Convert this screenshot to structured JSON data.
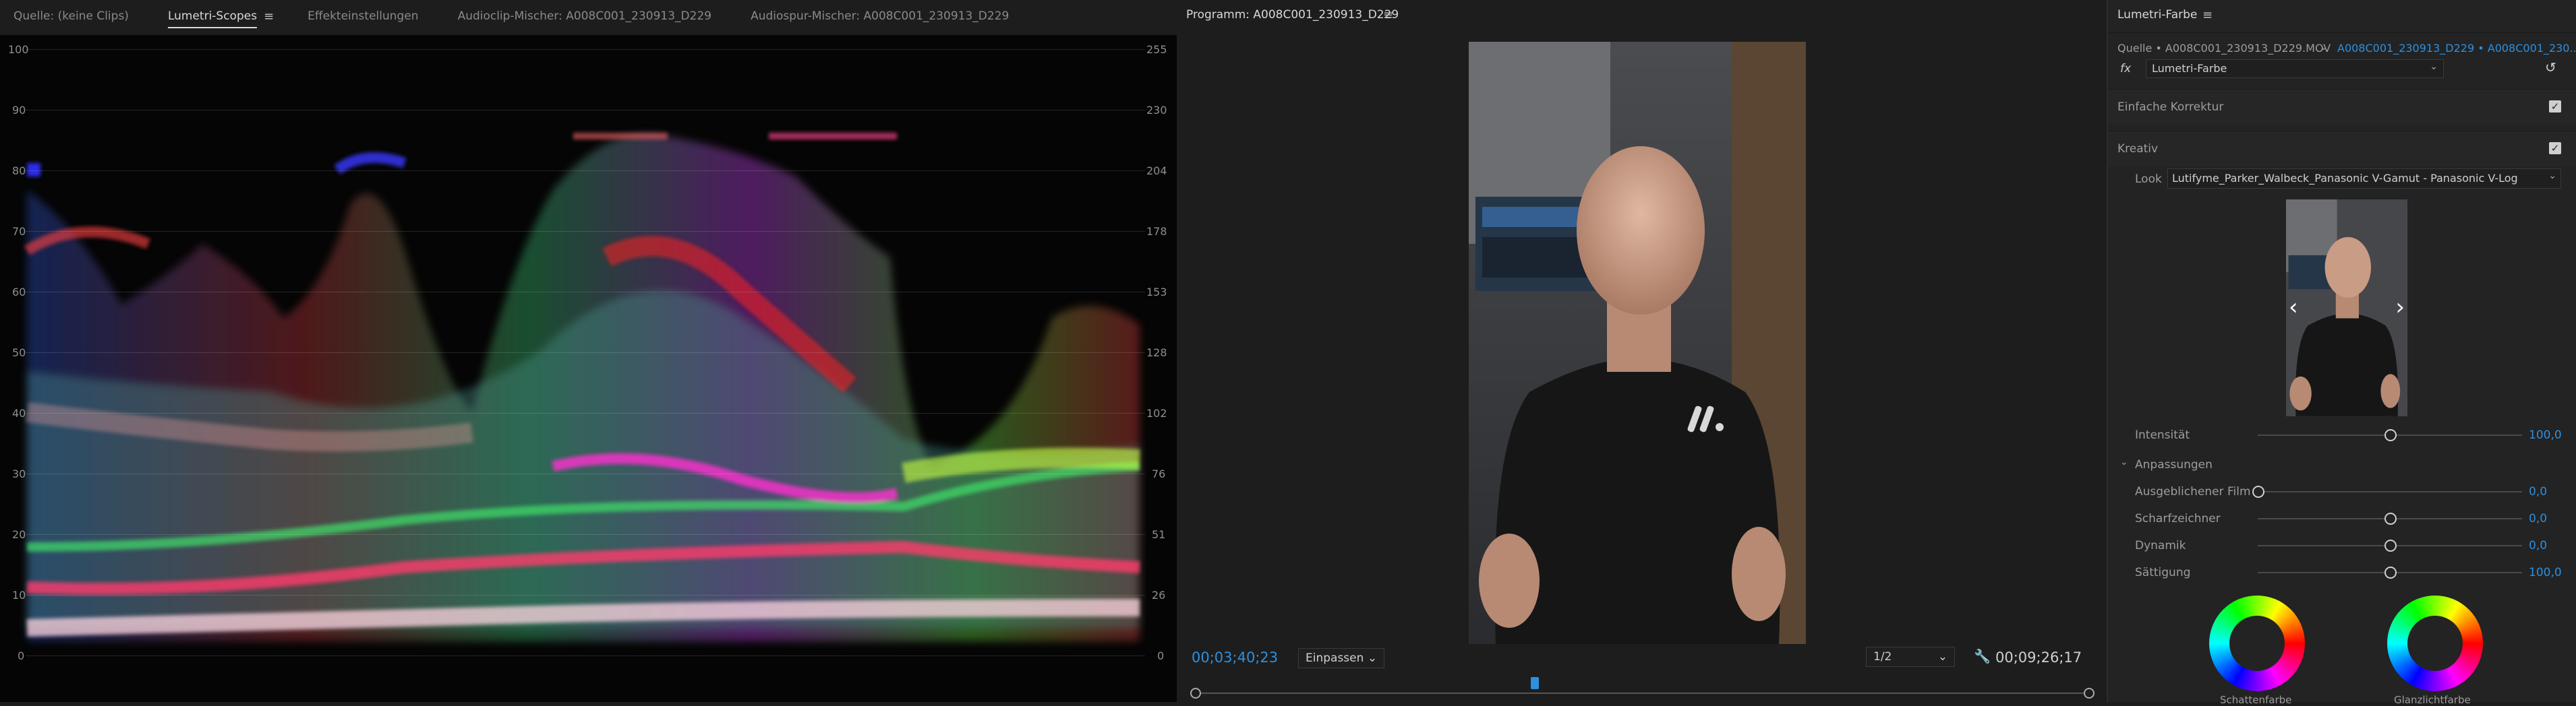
{
  "scopes_panel": {
    "tabs": [
      "Quelle: (keine Clips)",
      "Lumetri-Scopes",
      "Effekteinstellungen",
      "Audioclip-Mischer: A008C001_230913_D229",
      "Audiospur-Mischer: A008C001_230913_D229"
    ],
    "left_scale": [
      "100",
      "90",
      "80",
      "70",
      "60",
      "50",
      "40",
      "30",
      "20",
      "10",
      "0"
    ],
    "right_scale": [
      "255",
      "230",
      "204",
      "178",
      "153",
      "128",
      "102",
      "76",
      "51",
      "26",
      "0"
    ]
  },
  "program_panel": {
    "title": "Programm: A008C001_230913_D229",
    "timecode_current": "00;03;40;23",
    "fit_label": "Einpassen",
    "resolution": "1/2",
    "timecode_total": "00;09;26;17"
  },
  "lumetri_panel": {
    "title": "Lumetri-Farbe",
    "source_label": "Quelle • A008C001_230913_D229.MOV",
    "sequence_label": "A008C001_230913_D229 • A008C001_230...",
    "effect_name": "Lumetri-Farbe",
    "fx_label": "fx",
    "section_basic": "Einfache Korrektur",
    "section_creative": "Kreativ",
    "look_label": "Look",
    "look_value": "Lutifyme_Parker_Walbeck_Panasonic V-Gamut - Panasonic V-Log",
    "intensity_label": "Intensität",
    "intensity_value": "100,0",
    "adjustments_label": "Anpassungen",
    "sliders": [
      {
        "label": "Ausgeblichener Film",
        "value": "0,0",
        "level": 0.0
      },
      {
        "label": "Scharfzeichner",
        "value": "0,0",
        "level": 0.5
      },
      {
        "label": "Dynamik",
        "value": "0,0",
        "level": 0.5
      },
      {
        "label": "Sättigung",
        "value": "100,0",
        "level": 0.5
      }
    ],
    "intensity_level": 0.5,
    "wheel_labels": [
      "Schattenfarbe",
      "Glanzlichtfarbe"
    ]
  },
  "colors": {
    "accent_blue": "#2e8fde",
    "panel_bg": "#232323",
    "scope_bg": "#050505"
  }
}
